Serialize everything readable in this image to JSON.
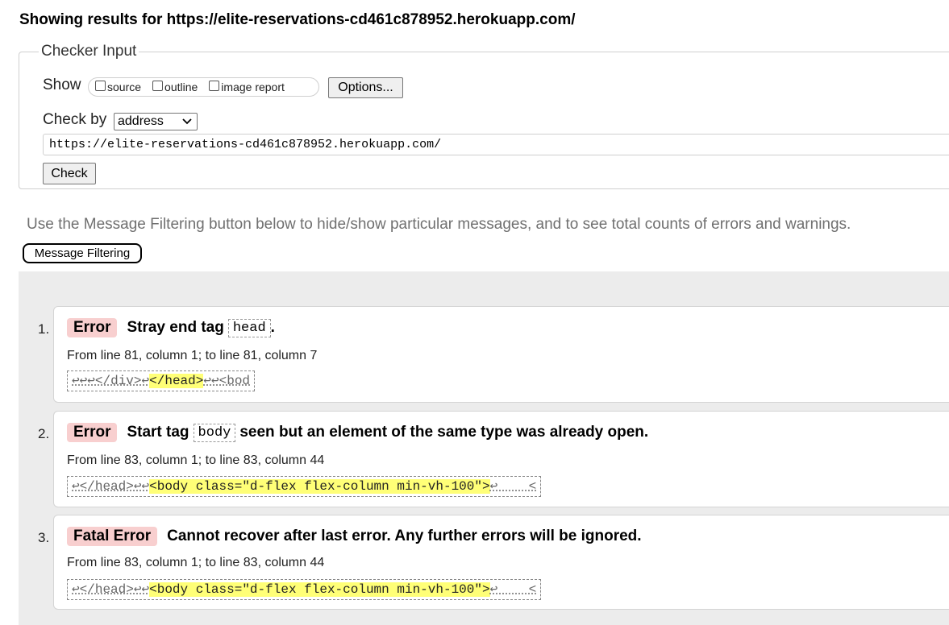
{
  "heading": "Showing results for https://elite-reservations-cd461c878952.herokuapp.com/",
  "checker": {
    "legend": "Checker Input",
    "show_label": "Show",
    "show_options": [
      "source",
      "outline",
      "image report"
    ],
    "options_button": "Options...",
    "checkby_label": "Check by",
    "checkby_value": "address",
    "url_value": "https://elite-reservations-cd461c878952.herokuapp.com/",
    "check_button": "Check"
  },
  "filter": {
    "hint": "Use the Message Filtering button below to hide/show particular messages, and to see total counts of errors and warnings.",
    "button": "Message Filtering"
  },
  "messages": [
    {
      "num": "1.",
      "type": "Error",
      "text_before": "Stray end tag",
      "code": "head",
      "text_after": ".",
      "location": "From line 81, column 1; to line 81, column 7",
      "extract_pre": "↩↩↩</div>↩",
      "extract_hl": "</head>",
      "extract_post": "↩↩<bod"
    },
    {
      "num": "2.",
      "type": "Error",
      "text_before": "Start tag",
      "code": "body",
      "text_after": "seen but an element of the same type was already open.",
      "location": "From line 83, column 1; to line 83, column 44",
      "extract_pre": "↩</head>↩↩",
      "extract_hl": "<body class=\"d-flex flex-column min-vh-100\">",
      "extract_post": "↩    <"
    },
    {
      "num": "3.",
      "type": "Fatal Error",
      "text_before": "Cannot recover after last error. Any further errors will be ignored.",
      "code": "",
      "text_after": "",
      "location": "From line 83, column 1; to line 83, column 44",
      "extract_pre": "↩</head>↩↩",
      "extract_hl": "<body class=\"d-flex flex-column min-vh-100\">",
      "extract_post": "↩    <"
    }
  ]
}
